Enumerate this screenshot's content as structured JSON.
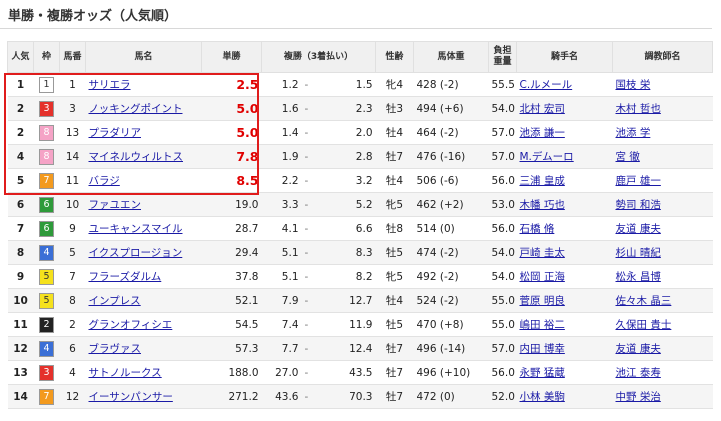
{
  "title": "単勝・複勝オッズ（人気順）",
  "headers": {
    "rank": "人気",
    "waku": "枠",
    "umaban": "馬番",
    "name": "馬名",
    "win": "単勝",
    "place": "複勝（3着払い）",
    "sexage": "性齢",
    "weight": "馬体重",
    "burden_1": "負担",
    "burden_2": "重量",
    "jockey": "騎手名",
    "trainer": "調教師名"
  },
  "colors": {
    "highlight": "#e01c1c",
    "hot_odds": "#e00000",
    "link": "#1a1aa6",
    "waku": {
      "1": {
        "bg": "#ffffff",
        "fg": "#333333"
      },
      "2": {
        "bg": "#222222",
        "fg": "#ffffff"
      },
      "3": {
        "bg": "#e4312b",
        "fg": "#ffffff"
      },
      "4": {
        "bg": "#3b6fd6",
        "fg": "#ffffff"
      },
      "5": {
        "bg": "#f5e11c",
        "fg": "#333333"
      },
      "6": {
        "bg": "#2e9a3a",
        "fg": "#ffffff"
      },
      "7": {
        "bg": "#f39a1e",
        "fg": "#ffffff"
      },
      "8": {
        "bg": "#f5a3c6",
        "fg": "#ffffff"
      }
    }
  },
  "rows": [
    {
      "rank": "1",
      "waku": "1",
      "num": "1",
      "name": "サリエラ",
      "win": "2.5",
      "pl_lo": "1.2",
      "sep": "-",
      "pl_hi": "1.5",
      "sexage": "牝4",
      "weight": "428 (-2)",
      "burden": "55.5",
      "jockey": "C.ルメール",
      "trainer": "国枝 栄",
      "hot": true
    },
    {
      "rank": "2",
      "waku": "3",
      "num": "3",
      "name": "ノッキングポイント",
      "win": "5.0",
      "pl_lo": "1.6",
      "sep": "-",
      "pl_hi": "2.3",
      "sexage": "牡3",
      "weight": "494 (+6)",
      "burden": "54.0",
      "jockey": "北村 宏司",
      "trainer": "木村 哲也",
      "hot": true
    },
    {
      "rank": "2",
      "waku": "8",
      "num": "13",
      "name": "プラダリア",
      "win": "5.0",
      "pl_lo": "1.4",
      "sep": "-",
      "pl_hi": "2.0",
      "sexage": "牡4",
      "weight": "464 (-2)",
      "burden": "57.0",
      "jockey": "池添 謙一",
      "trainer": "池添 学",
      "hot": true
    },
    {
      "rank": "4",
      "waku": "8",
      "num": "14",
      "name": "マイネルウィルトス",
      "win": "7.8",
      "pl_lo": "1.9",
      "sep": "-",
      "pl_hi": "2.8",
      "sexage": "牡7",
      "weight": "476 (-16)",
      "burden": "57.0",
      "jockey": "M.デムーロ",
      "trainer": "宮 徹",
      "hot": true
    },
    {
      "rank": "5",
      "waku": "7",
      "num": "11",
      "name": "バラジ",
      "win": "8.5",
      "pl_lo": "2.2",
      "sep": "-",
      "pl_hi": "3.2",
      "sexage": "牡4",
      "weight": "506 (-6)",
      "burden": "56.0",
      "jockey": "三浦 皇成",
      "trainer": "鹿戸 雄一",
      "hot": true
    },
    {
      "rank": "6",
      "waku": "6",
      "num": "10",
      "name": "ファユエン",
      "win": "19.0",
      "pl_lo": "3.3",
      "sep": "-",
      "pl_hi": "5.2",
      "sexage": "牝5",
      "weight": "462 (+2)",
      "burden": "53.0",
      "jockey": "木幡 巧也",
      "trainer": "勢司 和浩",
      "hot": false
    },
    {
      "rank": "7",
      "waku": "6",
      "num": "9",
      "name": "ユーキャンスマイル",
      "win": "28.7",
      "pl_lo": "4.1",
      "sep": "-",
      "pl_hi": "6.6",
      "sexage": "牡8",
      "weight": "514 (0)",
      "burden": "56.0",
      "jockey": "石橋 脩",
      "trainer": "友道 康夫",
      "hot": false
    },
    {
      "rank": "8",
      "waku": "4",
      "num": "5",
      "name": "イクスプロージョン",
      "win": "29.4",
      "pl_lo": "5.1",
      "sep": "-",
      "pl_hi": "8.3",
      "sexage": "牡5",
      "weight": "474 (-2)",
      "burden": "54.0",
      "jockey": "戸崎 圭太",
      "trainer": "杉山 晴紀",
      "hot": false
    },
    {
      "rank": "9",
      "waku": "5",
      "num": "7",
      "name": "フラーズダルム",
      "win": "37.8",
      "pl_lo": "5.1",
      "sep": "-",
      "pl_hi": "8.2",
      "sexage": "牝5",
      "weight": "492 (-2)",
      "burden": "54.0",
      "jockey": "松岡 正海",
      "trainer": "松永 昌博",
      "hot": false
    },
    {
      "rank": "10",
      "waku": "5",
      "num": "8",
      "name": "インプレス",
      "win": "52.1",
      "pl_lo": "7.9",
      "sep": "-",
      "pl_hi": "12.7",
      "sexage": "牡4",
      "weight": "524 (-2)",
      "burden": "55.0",
      "jockey": "菅原 明良",
      "trainer": "佐々木 晶三",
      "hot": false
    },
    {
      "rank": "11",
      "waku": "2",
      "num": "2",
      "name": "グランオフィシエ",
      "win": "54.5",
      "pl_lo": "7.4",
      "sep": "-",
      "pl_hi": "11.9",
      "sexage": "牡5",
      "weight": "470 (+8)",
      "burden": "55.0",
      "jockey": "嶋田 裕二",
      "trainer": "久保田 貴士",
      "hot": false
    },
    {
      "rank": "12",
      "waku": "4",
      "num": "6",
      "name": "ブラヴァス",
      "win": "57.3",
      "pl_lo": "7.7",
      "sep": "-",
      "pl_hi": "12.4",
      "sexage": "牡7",
      "weight": "496 (-14)",
      "burden": "57.0",
      "jockey": "内田 博幸",
      "trainer": "友道 康夫",
      "hot": false
    },
    {
      "rank": "13",
      "waku": "3",
      "num": "4",
      "name": "サトノルークス",
      "win": "188.0",
      "pl_lo": "27.0",
      "sep": "-",
      "pl_hi": "43.5",
      "sexage": "牡7",
      "weight": "496 (+10)",
      "burden": "56.0",
      "jockey": "永野 猛蔵",
      "trainer": "池江 泰寿",
      "hot": false
    },
    {
      "rank": "14",
      "waku": "7",
      "num": "12",
      "name": "イーサンパンサー",
      "win": "271.2",
      "pl_lo": "43.6",
      "sep": "-",
      "pl_hi": "70.3",
      "sexage": "牡7",
      "weight": "472 (0)",
      "burden": "52.0",
      "jockey": "小林 美駒",
      "trainer": "中野 栄治",
      "hot": false
    }
  ]
}
